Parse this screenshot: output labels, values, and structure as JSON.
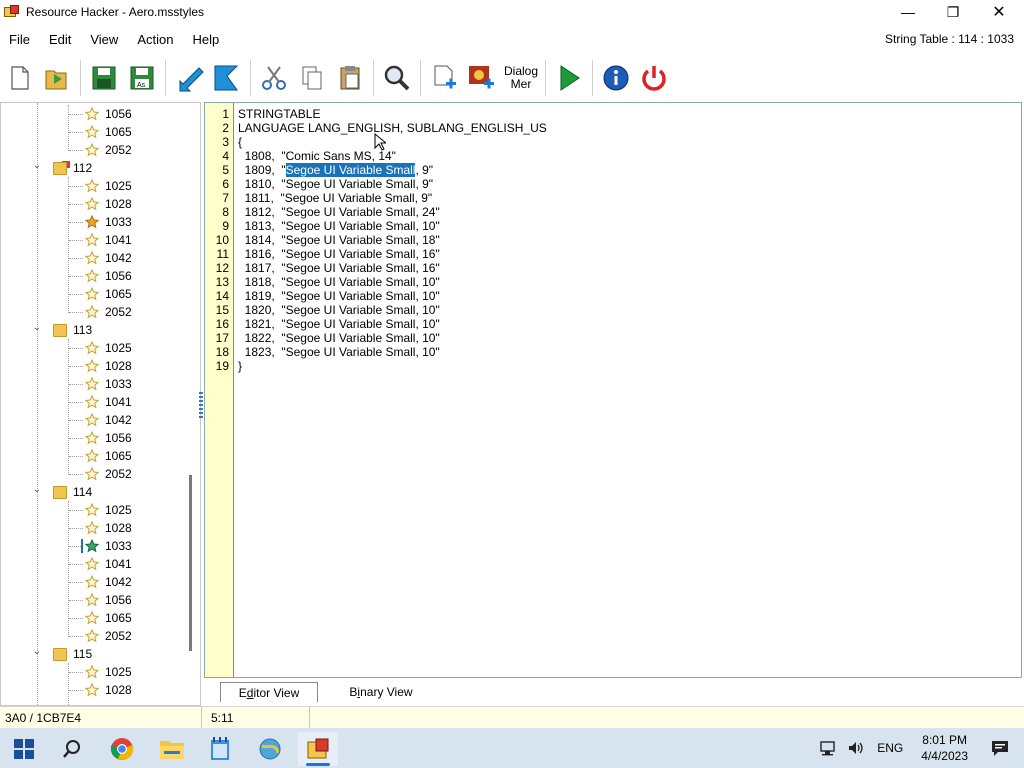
{
  "window": {
    "title": "Resource Hacker - Aero.msstyles",
    "min": "—",
    "max": "❐",
    "close": "✕"
  },
  "menu": [
    "File",
    "Edit",
    "View",
    "Action",
    "Help"
  ],
  "status_right": "String Table : 114 : 1033",
  "toolbar": {
    "dialog_label_1": "Dialog",
    "dialog_label_2": "Mer"
  },
  "tree": {
    "rows": [
      {
        "kind": "leaf",
        "label": "1056"
      },
      {
        "kind": "leaf",
        "label": "1065"
      },
      {
        "kind": "leaf",
        "label": "2052"
      },
      {
        "kind": "folder",
        "label": "112"
      },
      {
        "kind": "leaf",
        "label": "1025"
      },
      {
        "kind": "leaf",
        "label": "1028"
      },
      {
        "kind": "leaf-gold",
        "label": "1033"
      },
      {
        "kind": "leaf",
        "label": "1041"
      },
      {
        "kind": "leaf",
        "label": "1042"
      },
      {
        "kind": "leaf",
        "label": "1056"
      },
      {
        "kind": "leaf",
        "label": "1065"
      },
      {
        "kind": "leaf",
        "label": "2052"
      },
      {
        "kind": "folder",
        "label": "113"
      },
      {
        "kind": "leaf",
        "label": "1025"
      },
      {
        "kind": "leaf",
        "label": "1028"
      },
      {
        "kind": "leaf",
        "label": "1033"
      },
      {
        "kind": "leaf",
        "label": "1041"
      },
      {
        "kind": "leaf",
        "label": "1042"
      },
      {
        "kind": "leaf",
        "label": "1056"
      },
      {
        "kind": "leaf",
        "label": "1065"
      },
      {
        "kind": "leaf",
        "label": "2052"
      },
      {
        "kind": "folder",
        "label": "114"
      },
      {
        "kind": "leaf",
        "label": "1025"
      },
      {
        "kind": "leaf",
        "label": "1028"
      },
      {
        "kind": "leaf-green",
        "label": "1033"
      },
      {
        "kind": "leaf",
        "label": "1041"
      },
      {
        "kind": "leaf",
        "label": "1042"
      },
      {
        "kind": "leaf",
        "label": "1056"
      },
      {
        "kind": "leaf",
        "label": "1065"
      },
      {
        "kind": "leaf",
        "label": "2052"
      },
      {
        "kind": "folder",
        "label": "115"
      },
      {
        "kind": "leaf",
        "label": "1025"
      },
      {
        "kind": "leaf",
        "label": "1028"
      }
    ]
  },
  "editor": {
    "lines": [
      {
        "n": "1",
        "text": "STRINGTABLE"
      },
      {
        "n": "2",
        "text": "LANGUAGE LANG_ENGLISH, SUBLANG_ENGLISH_US"
      },
      {
        "n": "3",
        "text": "{"
      },
      {
        "n": "4",
        "text": "  1808,  \"Comic Sans MS, 14\""
      },
      {
        "n": "5",
        "pre": "  1809,  \"",
        "hl": "Segoe UI Variable Small",
        "post": ", 9\""
      },
      {
        "n": "6",
        "text": "  1810,  \"Segoe UI Variable Small, 9\""
      },
      {
        "n": "7",
        "text": "  1811,  \"Segoe UI Variable Small, 9\""
      },
      {
        "n": "8",
        "text": "  1812,  \"Segoe UI Variable Small, 24\""
      },
      {
        "n": "9",
        "text": "  1813,  \"Segoe UI Variable Small, 10\""
      },
      {
        "n": "10",
        "text": "  1814,  \"Segoe UI Variable Small, 18\""
      },
      {
        "n": "11",
        "text": "  1816,  \"Segoe UI Variable Small, 16\""
      },
      {
        "n": "12",
        "text": "  1817,  \"Segoe UI Variable Small, 16\""
      },
      {
        "n": "13",
        "text": "  1818,  \"Segoe UI Variable Small, 10\""
      },
      {
        "n": "14",
        "text": "  1819,  \"Segoe UI Variable Small, 10\""
      },
      {
        "n": "15",
        "text": "  1820,  \"Segoe UI Variable Small, 10\""
      },
      {
        "n": "16",
        "text": "  1821,  \"Segoe UI Variable Small, 10\""
      },
      {
        "n": "17",
        "text": "  1822,  \"Segoe UI Variable Small, 10\""
      },
      {
        "n": "18",
        "text": "  1823,  \"Segoe UI Variable Small, 10\""
      },
      {
        "n": "19",
        "text": "}"
      }
    ]
  },
  "tabs": {
    "editor_pre": "E",
    "editor_u": "d",
    "editor_post": "itor View",
    "binary_pre": "B",
    "binary_u": "i",
    "binary_post": "nary View"
  },
  "statusbar": {
    "offset": "3A0 / 1CB7E4",
    "position": "5:11"
  },
  "taskbar": {
    "language": "ENG",
    "time": "8:01 PM",
    "date": "4/4/2023"
  },
  "colors": {
    "gutter": "#ffffcc",
    "selection": "#1a73b8",
    "taskbar": "#d7e3ef"
  }
}
